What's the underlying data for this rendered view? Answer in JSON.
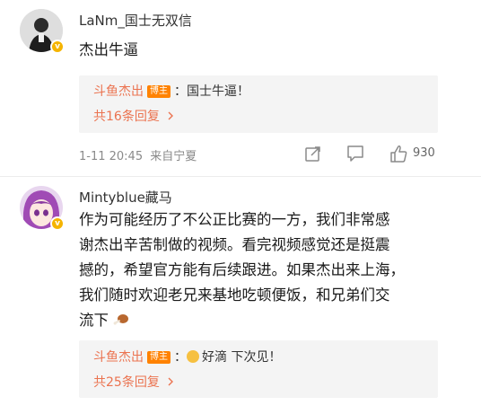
{
  "comments": [
    {
      "username": "LaNm_国士无双信",
      "text": "杰出牛逼",
      "reply": {
        "author": "斗鱼杰出",
        "tag": "博主",
        "sep": "：",
        "text": "国士牛逼！"
      },
      "more_replies": "共16条回复",
      "time": "1-11 20:45",
      "location": "来自宁夏",
      "likes": "930"
    },
    {
      "username": "Mintyblue藏马",
      "text_lines": [
        "作为可能经历了不公正比赛的一方，我们非常感",
        "谢杰出辛苦制做的视频。看完视频感觉还是挺震",
        "撼的，希望官方能有后续跟进。如果杰出来上海，",
        "我们随时欢迎老兄来基地吃顿便饭，和兄弟们交",
        "流下"
      ],
      "reply": {
        "author": "斗鱼杰出",
        "tag": "博主",
        "sep": "：",
        "text": "好滴 下次见！"
      },
      "more_replies": "共25条回复"
    }
  ],
  "icons": {
    "more_chevron": "chevron-right-icon",
    "share": "share-icon",
    "comment": "comment-icon",
    "like": "thumbs-up-icon",
    "verified": "verified-badge-icon"
  },
  "colors": {
    "reply_author": "#eb7350",
    "tag_bg": "#ff8200",
    "verified": "#f5b400"
  }
}
